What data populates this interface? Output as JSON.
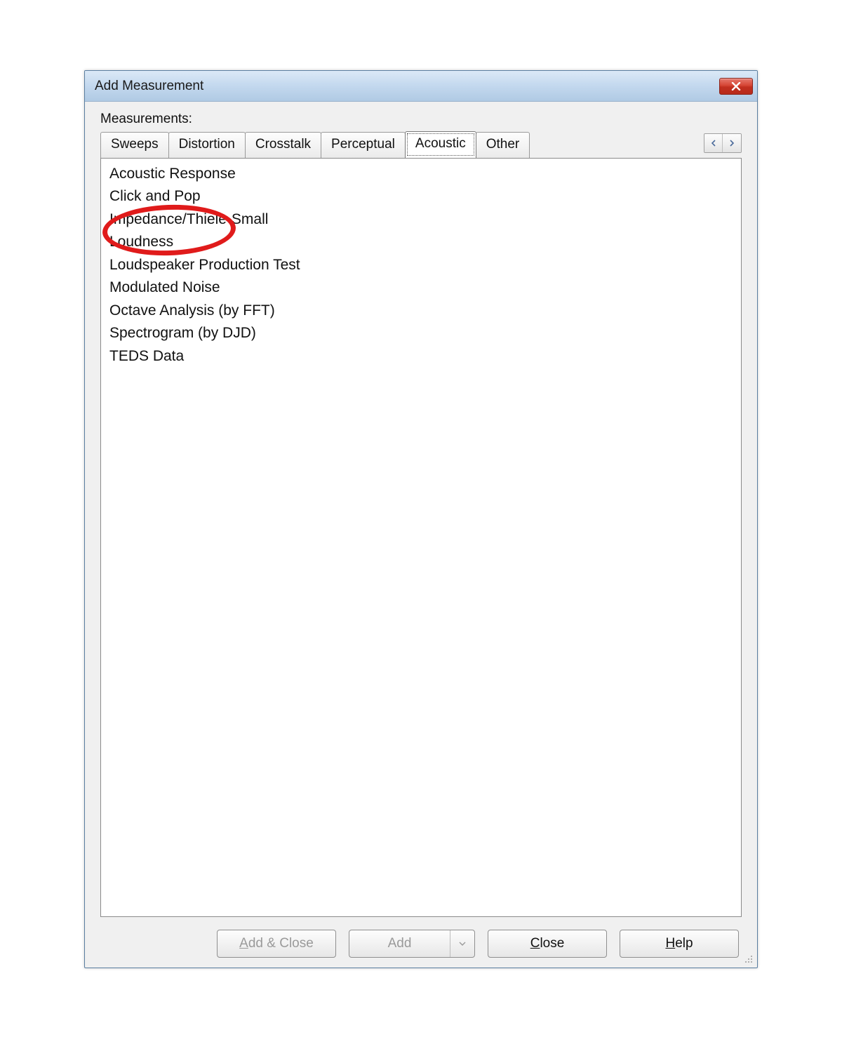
{
  "window": {
    "title": "Add Measurement"
  },
  "section_label": "Measurements:",
  "tabs": [
    {
      "label": "Sweeps"
    },
    {
      "label": "Distortion"
    },
    {
      "label": "Crosstalk"
    },
    {
      "label": "Perceptual"
    },
    {
      "label": "Acoustic"
    },
    {
      "label": "Other"
    }
  ],
  "active_tab_index": 4,
  "list": {
    "items": [
      "Acoustic Response",
      "Click and Pop",
      "Impedance/Thiele-Small",
      "Loudness",
      "Loudspeaker Production Test",
      "Modulated Noise",
      "Octave Analysis (by FFT)",
      "Spectrogram (by DJD)",
      "TEDS Data"
    ],
    "highlighted_item": "Loudness"
  },
  "buttons": {
    "add_close": "Add & Close",
    "add": "Add",
    "close": "Close",
    "help": "Help"
  },
  "icons": {
    "close": "close-icon",
    "tab_left": "chevron-left-icon",
    "tab_right": "chevron-right-icon",
    "dropdown": "caret-down-icon",
    "resize": "resize-grip-icon"
  }
}
